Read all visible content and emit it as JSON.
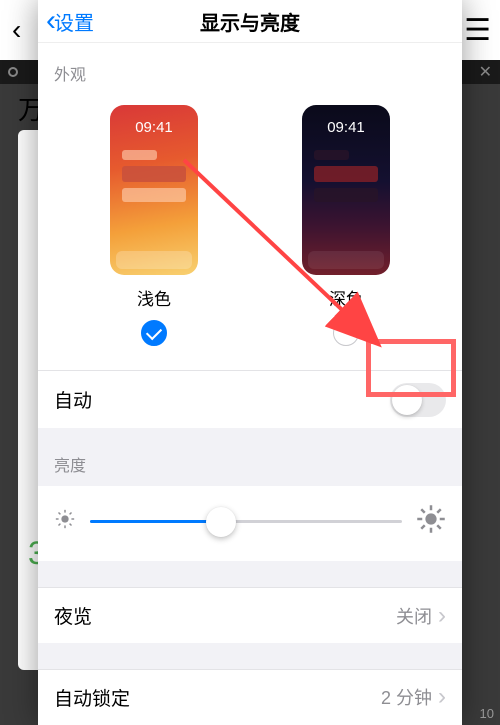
{
  "background": {
    "side_char": "万",
    "step_num": "3",
    "pager": "10"
  },
  "nav": {
    "back_label": "设置",
    "title": "显示与亮度"
  },
  "appearance": {
    "header": "外观",
    "thumb_time": "09:41",
    "light_label": "浅色",
    "dark_label": "深色"
  },
  "rows": {
    "auto_label": "自动",
    "brightness_header": "亮度",
    "night_shift_label": "夜览",
    "night_shift_value": "关闭",
    "auto_lock_label": "自动锁定",
    "auto_lock_value": "2 分钟"
  }
}
